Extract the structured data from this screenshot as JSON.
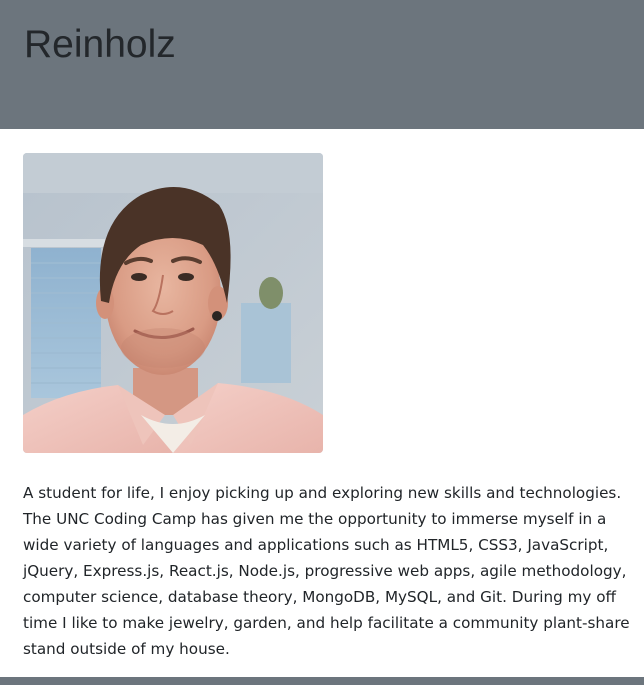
{
  "header": {
    "title": "Reinholz"
  },
  "profile": {
    "photo_alt": "Portrait photo of Reinholz",
    "bio": "A student for life, I enjoy picking up and exploring new skills and technologies. The UNC Coding Camp has given me the opportunity to immerse myself in a wide variety of languages and applications such as HTML5, CSS3, JavaScript, jQuery, Express.js, React.js, Node.js, progressive web apps, agile methodology, computer science, database theory, MongoDB, MySQL, and Git. During my off time I like to make jewelry, garden, and help facilitate a community plant-share stand outside of my house."
  },
  "colors": {
    "header_bg": "#6c757d",
    "title_text": "#23272b",
    "body_text": "#212529",
    "footer_bg": "#6c757d"
  }
}
